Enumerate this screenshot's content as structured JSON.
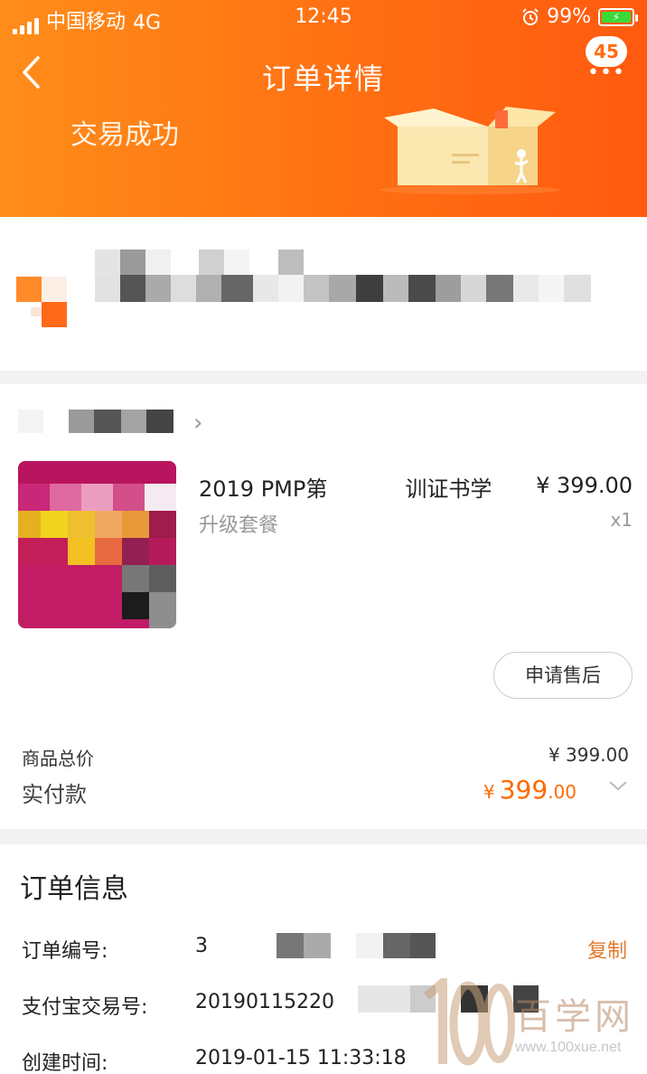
{
  "statusbar": {
    "carrier": "中国移动",
    "network": "4G",
    "time": "12:45",
    "battery": "99%"
  },
  "header": {
    "back_icon": "chevron-left-icon",
    "title": "订单详情",
    "badge": "45",
    "status": "交易成功",
    "background": "#ff7a14"
  },
  "product": {
    "name_part1": "2019 PMP第",
    "name_part2": "训证书学",
    "sku": "升级套餐",
    "price": "¥ 399.00",
    "qty": "x1",
    "after_sale_label": "申请售后"
  },
  "totals": {
    "goods_total_label": "商品总价",
    "goods_total_value": "¥ 399.00",
    "paid_label": "实付款",
    "paid_currency": "¥",
    "paid_integer": "399",
    "paid_decimal": ".00",
    "accent": "#ff6a00"
  },
  "order_info": {
    "title": "订单信息",
    "order_no_label": "订单编号:",
    "order_no_value": "3",
    "copy_label": "复制",
    "alipay_label": "支付宝交易号:",
    "alipay_value": "20190115220",
    "created_label": "创建时间:",
    "created_value": "2019-01-15 11:33:18"
  },
  "watermark": {
    "text": "百学网",
    "url": "www.100xue.net"
  }
}
